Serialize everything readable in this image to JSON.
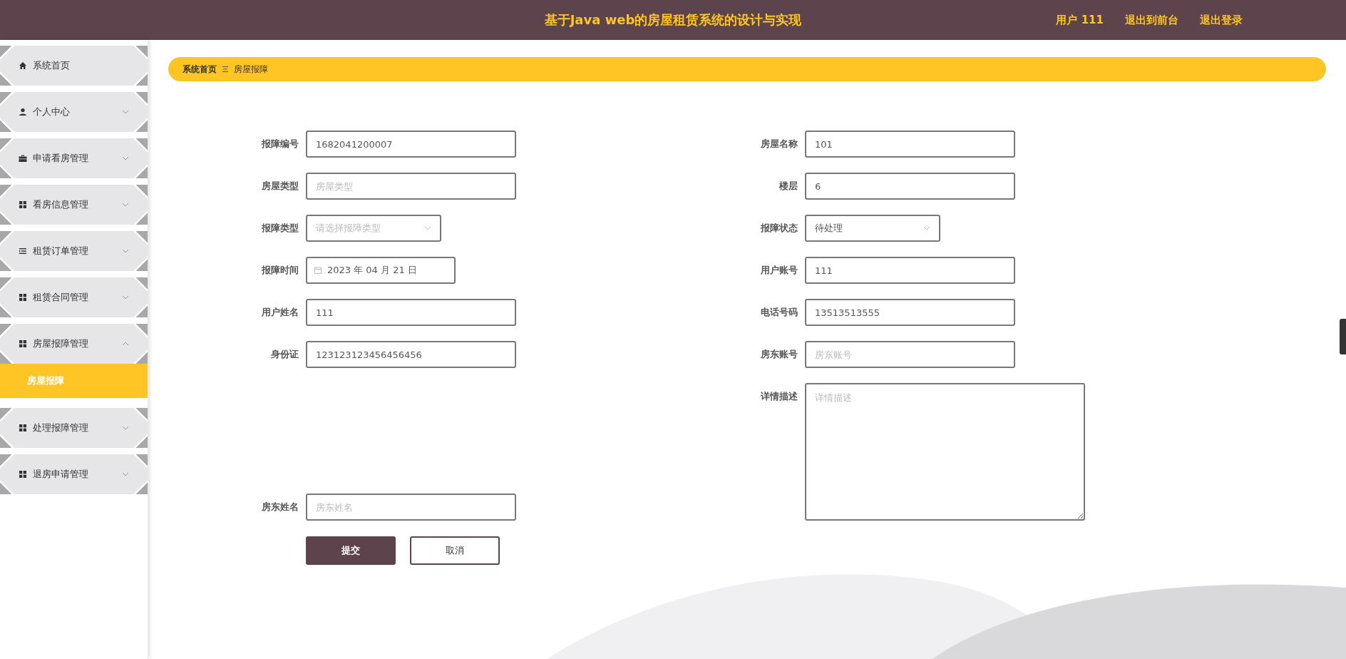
{
  "header": {
    "title": "基于Java web的房屋租赁系统的设计与实现",
    "user": "用户 111",
    "links": [
      "退出到前台",
      "退出登录"
    ]
  },
  "sidebar": {
    "items": [
      {
        "label": "系统首页",
        "kind": "link"
      },
      {
        "label": "个人中心",
        "kind": "menu",
        "expanded": false
      },
      {
        "label": "申请看房管理",
        "kind": "menu",
        "expanded": false
      },
      {
        "label": "看房信息管理",
        "kind": "menu",
        "expanded": false
      },
      {
        "label": "租赁订单管理",
        "kind": "menu",
        "expanded": false
      },
      {
        "label": "租赁合同管理",
        "kind": "menu",
        "expanded": false
      },
      {
        "label": "房屋报障管理",
        "kind": "menu",
        "expanded": true,
        "children": [
          {
            "label": "房屋报障",
            "selected": true
          }
        ]
      },
      {
        "label": "处理报障管理",
        "kind": "menu",
        "expanded": false
      },
      {
        "label": "退房申请管理",
        "kind": "menu",
        "expanded": false
      }
    ]
  },
  "breadcrumb": [
    "系统首页",
    "房屋报障"
  ],
  "form": {
    "left_fields": [
      {
        "label": "报障编号",
        "kind": "text",
        "value": "1682041200007"
      },
      {
        "label": "房屋类型",
        "kind": "text",
        "placeholder": "房屋类型"
      },
      {
        "label": "报障类型",
        "kind": "select",
        "placeholder": "请选择报障类型"
      },
      {
        "label": "报障时间",
        "kind": "date",
        "value": "2023 年 04 月 21 日"
      },
      {
        "label": "用户姓名",
        "kind": "text",
        "value": "111"
      },
      {
        "label": "身份证",
        "kind": "text",
        "value": "123123123456456456"
      },
      {
        "label": "房东姓名",
        "kind": "text",
        "placeholder": "房东姓名"
      }
    ],
    "right_fields": [
      {
        "label": "房屋名称",
        "kind": "text",
        "value": "101"
      },
      {
        "label": "楼层",
        "kind": "text",
        "value": "6"
      },
      {
        "label": "报障状态",
        "kind": "select",
        "value": "待处理"
      },
      {
        "label": "用户账号",
        "kind": "text",
        "value": "111"
      },
      {
        "label": "电话号码",
        "kind": "text",
        "value": "13513513555"
      },
      {
        "label": "房东账号",
        "kind": "text",
        "placeholder": "房东账号"
      },
      {
        "label": "详情描述",
        "kind": "textarea",
        "placeholder": "详情描述"
      }
    ],
    "buttons": [
      {
        "label": "提交",
        "kind": "primary"
      },
      {
        "label": "取消",
        "kind": "secondary"
      }
    ]
  }
}
